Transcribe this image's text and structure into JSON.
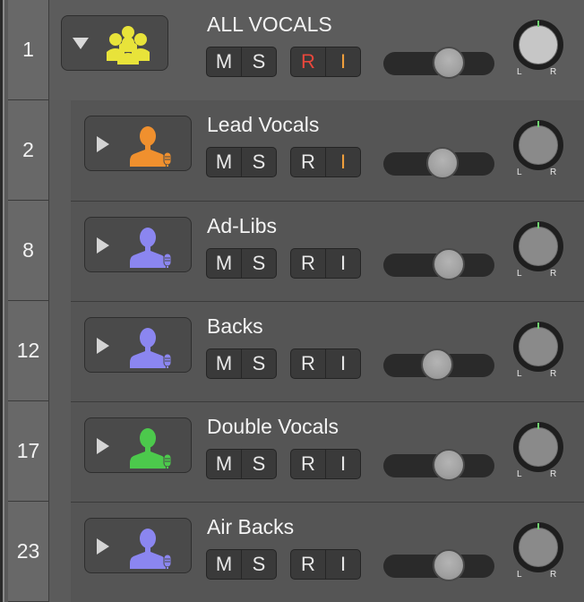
{
  "tracks": [
    {
      "number": "1",
      "name": "ALL VOCALS",
      "kind": "folder",
      "icon": "group-people-icon",
      "icon_color": "#e8e33a",
      "mute": "M",
      "solo": "S",
      "record": "R",
      "input": "I",
      "record_color": "#e8473c",
      "input_color": "#f2a03c",
      "volume": 0.62,
      "pan": 0
    },
    {
      "number": "2",
      "name": "Lead Vocals",
      "kind": "child",
      "icon": "singer-icon",
      "icon_color": "#f0902e",
      "mute": "M",
      "solo": "S",
      "record": "R",
      "input": "I",
      "record_color": "#e8e8e8",
      "input_color": "#f2a03c",
      "volume": 0.55,
      "pan": 0
    },
    {
      "number": "8",
      "name": "Ad-Libs",
      "kind": "child",
      "icon": "singer-icon",
      "icon_color": "#8b86f0",
      "mute": "M",
      "solo": "S",
      "record": "R",
      "input": "I",
      "record_color": "#e8e8e8",
      "input_color": "#e8e8e8",
      "volume": 0.62,
      "pan": 0
    },
    {
      "number": "12",
      "name": "Backs",
      "kind": "child",
      "icon": "singer-icon",
      "icon_color": "#8b86f0",
      "mute": "M",
      "solo": "S",
      "record": "R",
      "input": "I",
      "record_color": "#e8e8e8",
      "input_color": "#e8e8e8",
      "volume": 0.48,
      "pan": 0
    },
    {
      "number": "17",
      "name": "Double Vocals",
      "kind": "child",
      "icon": "singer-icon",
      "icon_color": "#4cc94c",
      "mute": "M",
      "solo": "S",
      "record": "R",
      "input": "I",
      "record_color": "#e8e8e8",
      "input_color": "#e8e8e8",
      "volume": 0.62,
      "pan": 0
    },
    {
      "number": "23",
      "name": "Air Backs",
      "kind": "child",
      "icon": "singer-icon",
      "icon_color": "#8b86f0",
      "mute": "M",
      "solo": "S",
      "record": "R",
      "input": "I",
      "record_color": "#e8e8e8",
      "input_color": "#e8e8e8",
      "volume": 0.62,
      "pan": 0
    }
  ],
  "pan_labels": {
    "left": "L",
    "right": "R"
  }
}
